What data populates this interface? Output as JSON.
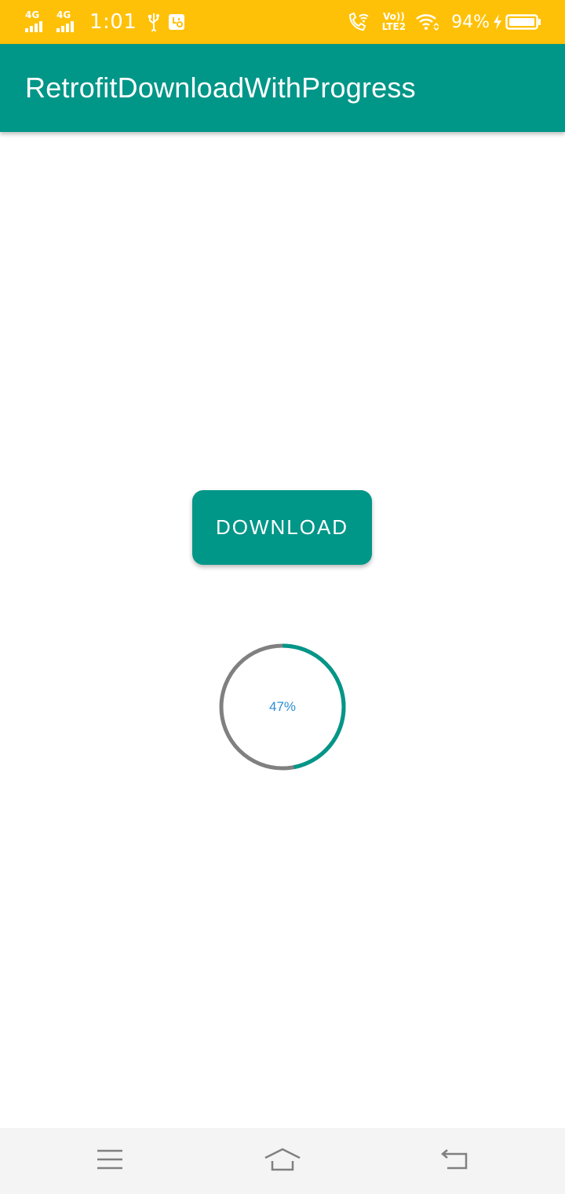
{
  "status_bar": {
    "network_1": "4G",
    "network_2": "4G",
    "time": "1:01",
    "volte_top": "Vo))",
    "volte_bottom": "LTE2",
    "battery_percent": "94%",
    "icons": [
      "signal-icon",
      "signal-icon",
      "usb-icon",
      "notification-app-icon",
      "wifi-calling-icon",
      "volte-icon",
      "wifi-icon",
      "charging-icon",
      "battery-icon"
    ]
  },
  "app_bar": {
    "title": "RetrofitDownloadWithProgress"
  },
  "main": {
    "download_label": "DOWNLOAD",
    "progress": {
      "value": 0.47,
      "label": "47%"
    }
  },
  "nav_bar": {
    "icons": [
      "menu-icon",
      "home-icon",
      "back-icon"
    ]
  },
  "colors": {
    "status_bar": "#FFC107",
    "primary": "#009688",
    "progress_track": "#808080",
    "progress_text": "#2E8FD6",
    "nav_bar": "#F4F4F4"
  }
}
